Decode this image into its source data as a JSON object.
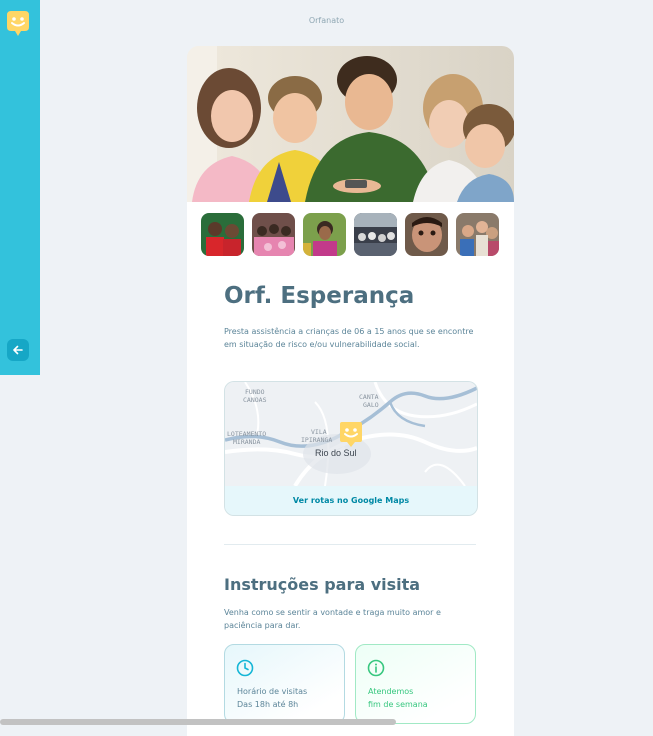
{
  "page": {
    "title": "Orfanato"
  },
  "sidebar": {
    "logo_icon": "smiley-pin-icon",
    "back_icon": "arrow-left-icon"
  },
  "orphanage": {
    "name": "Orf. Esperança",
    "about": "Presta assistência a crianças de 06 a 15 anos que se encontre em situação de risco e/ou vulnerabilidade social."
  },
  "map": {
    "labels": {
      "fundo_1": "FUNDO",
      "fundo_2": "CANOAS",
      "canta_1": "CANTA",
      "canta_2": "GALO",
      "lot_1": "LOTEAMENTO",
      "lot_2": "MIRANDA",
      "vila_1": "VILA",
      "vila_2": "IPIRANGA",
      "city": "Rio do Sul"
    },
    "link_label": "Ver rotas no Google Maps"
  },
  "instructions": {
    "title": "Instruções para visita",
    "text": "Venha como se sentir a vontade e traga muito amor e paciência para dar."
  },
  "hours": {
    "label": "Horário de visitas",
    "value": "Das 18h até 8h",
    "icon": "clock-icon"
  },
  "weekend": {
    "label": "Atendemos",
    "value": "fim de semana",
    "icon": "info-icon"
  },
  "colors": {
    "accent": "#15c3d6",
    "sidebar": "#33c2dc",
    "title": "#4d6f80",
    "green": "#37c77f"
  }
}
